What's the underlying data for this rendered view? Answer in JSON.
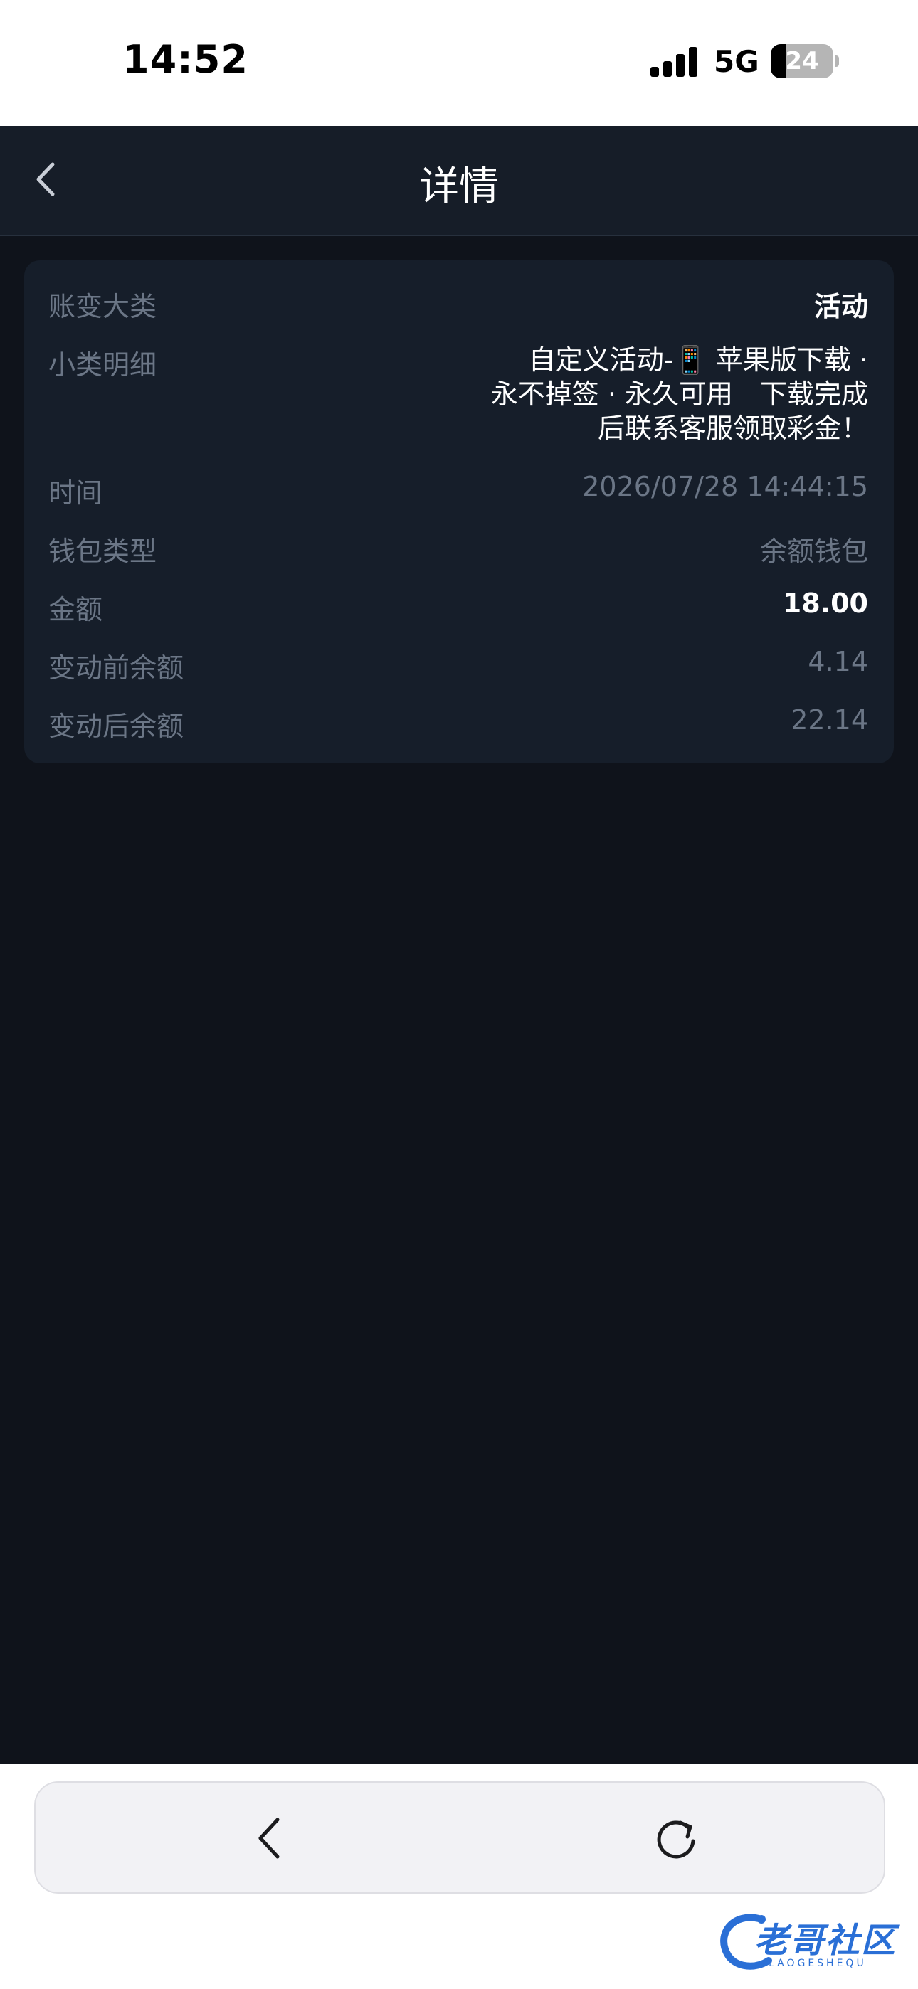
{
  "status_bar": {
    "time": "14:52",
    "network": "5G",
    "battery": "24",
    "battery_level": 0.24
  },
  "header": {
    "title": "详情",
    "back_icon": "chevron-left-icon"
  },
  "detail": {
    "rows": [
      {
        "label": "账变大类",
        "value": "活动"
      },
      {
        "label": "小类明细",
        "value_lines": [
          "自定义活动-📱 苹果版下载 ·",
          "永不掉签 · 永久可用　下载完成",
          "后联系客服领取彩金！"
        ]
      },
      {
        "label": "时间",
        "value": "2026/07/28 14:44:15"
      },
      {
        "label": "钱包类型",
        "value": "余额钱包"
      },
      {
        "label": "金额",
        "value": "18.00"
      },
      {
        "label": "变动前余额",
        "value": "4.14"
      },
      {
        "label": "变动后余额",
        "value": "22.14"
      }
    ]
  },
  "browser_toolbar": {
    "back_icon": "chevron-left-icon",
    "refresh_icon": "refresh-icon"
  },
  "watermark": {
    "text": "老哥社区",
    "sub": "LAOGESHEQU"
  },
  "colors": {
    "background": "#0f131b",
    "card": "#161e2a",
    "nav": "#161d28",
    "label": "#6b7686",
    "value_bright": "#ffffff"
  }
}
